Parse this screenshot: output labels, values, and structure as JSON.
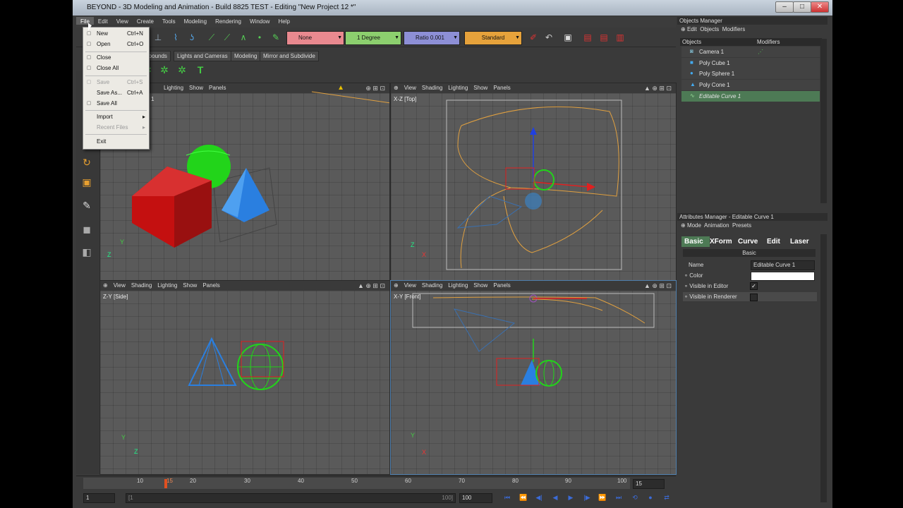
{
  "window": {
    "title": "BEYOND - 3D Modeling and Animation - Build 8825 TEST - Editing \"New Project 12 *\""
  },
  "menubar": [
    "File",
    "Edit",
    "View",
    "Create",
    "Tools",
    "Modeling",
    "Rendering",
    "Window",
    "Help"
  ],
  "file_menu": {
    "items": [
      {
        "label": "New",
        "shortcut": "Ctrl+N",
        "enabled": true
      },
      {
        "label": "Open",
        "shortcut": "Ctrl+O",
        "enabled": true
      },
      {
        "label": "Close",
        "shortcut": "",
        "enabled": true
      },
      {
        "label": "Close All",
        "shortcut": "",
        "enabled": true
      },
      {
        "label": "Save",
        "shortcut": "Ctrl+S",
        "enabled": false
      },
      {
        "label": "Save As...",
        "shortcut": "Ctrl+A",
        "enabled": true
      },
      {
        "label": "Save All",
        "shortcut": "",
        "enabled": true
      },
      {
        "label": "Import",
        "shortcut": "",
        "enabled": true
      },
      {
        "label": "Recent Files",
        "shortcut": "",
        "enabled": false
      },
      {
        "label": "Exit",
        "shortcut": "",
        "enabled": true
      }
    ]
  },
  "toolbar": {
    "snap_mode": "None",
    "angle": "1 Degree",
    "ratio": "Ratio 0.001",
    "layout": "Standard"
  },
  "tabs": [
    "mpounds",
    "Lights and Cameras",
    "Modeling",
    "Mirror and Subdivide"
  ],
  "viewport_menu": {
    "view": "View",
    "shading": "Shading",
    "lighting": "Lighting",
    "show": "Show",
    "panels": "Panels"
  },
  "viewports": {
    "perspective": {
      "label": "1"
    },
    "top": {
      "label": "X-Z [Top]"
    },
    "side": {
      "label": "Z-Y [Side]"
    },
    "front": {
      "label": "X-Y [Front]"
    }
  },
  "timeline": {
    "ticks": [
      "10",
      "15",
      "20",
      "30",
      "40",
      "50",
      "60",
      "70",
      "80",
      "90",
      "100"
    ],
    "current_frame": "15",
    "start_frame": "1",
    "end_frame": "100",
    "range_start_value": "[1",
    "range_end_value": "100]"
  },
  "objects_manager": {
    "title": "Objects Manager",
    "menu": [
      "Edit",
      "Objects",
      "Modifiers"
    ],
    "columns": [
      "Objects",
      "Modifiers"
    ],
    "items": [
      "Camera 1",
      "Poly Cube 1",
      "Poly Sphere 1",
      "Poly Cone 1",
      "Editable Curve 1"
    ]
  },
  "attributes_manager": {
    "title": "Attributes Manager - Editable Curve 1",
    "menu": [
      "Mode",
      "Animation",
      "Presets"
    ],
    "tabs": [
      "Basic",
      "XForm",
      "Curve",
      "Edit",
      "Laser"
    ],
    "section": "Basic",
    "fields": {
      "name_label": "Name",
      "name_value": "Editable Curve 1",
      "color_label": "Color",
      "visible_editor_label": "Visible in Editor",
      "visible_renderer_label": "Visible in Renderer"
    }
  },
  "colors": {
    "cube": "#c41010",
    "sphere": "#22d41a",
    "cone": "#2a7fe0",
    "curve": "#e0a040",
    "selected": "#4d7a55"
  }
}
